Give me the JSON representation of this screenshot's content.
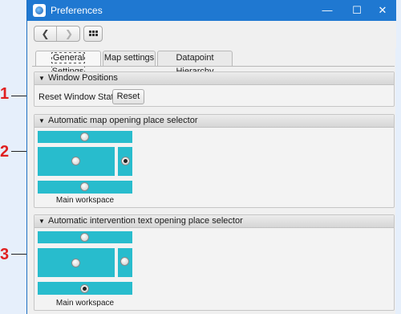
{
  "window": {
    "title": "Preferences",
    "controls": {
      "minimize": "—",
      "maximize": "☐",
      "close": "✕"
    }
  },
  "toolbar": {
    "back_glyph": "❮",
    "forward_glyph": "❯"
  },
  "tabs": [
    {
      "label": "General Settings",
      "active": true
    },
    {
      "label": "Map settings",
      "active": false
    },
    {
      "label": "Datapoint Hierarchy",
      "active": false
    }
  ],
  "sections": {
    "window_positions": {
      "header": "Window Positions",
      "reset_label": "Reset Window States",
      "reset_button": "Reset"
    },
    "map_selector": {
      "header": "Automatic map opening place selector",
      "selected": "right",
      "workspace_label": "Main workspace"
    },
    "intervention_selector": {
      "header": "Automatic intervention text opening place selector",
      "selected": "bottom",
      "workspace_label": "Main workspace"
    }
  },
  "callouts": [
    "1",
    "2",
    "3"
  ],
  "colors": {
    "titlebar": "#1f78d1",
    "zone": "#28bccd",
    "callout": "#e02020"
  }
}
